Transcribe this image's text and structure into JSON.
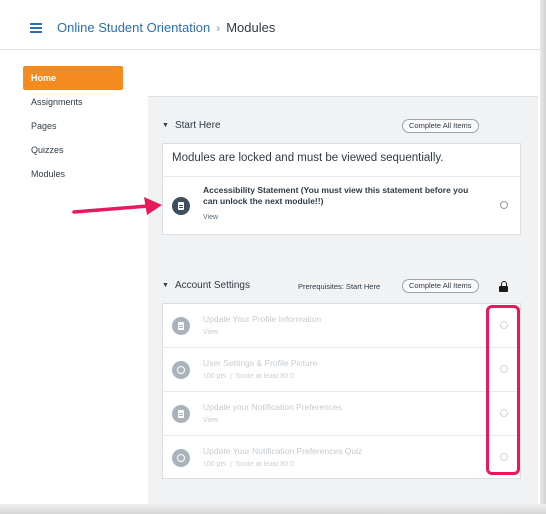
{
  "header": {
    "course": "Online Student Orientation",
    "separator": "›",
    "current": "Modules"
  },
  "sidebar": {
    "items": [
      {
        "label": "Home",
        "active": true
      },
      {
        "label": "Assignments"
      },
      {
        "label": "Pages"
      },
      {
        "label": "Quizzes"
      },
      {
        "label": "Modules"
      }
    ]
  },
  "modules": [
    {
      "title": "Start Here",
      "complete_all": "Complete All Items",
      "lock_message": "Modules are locked and must be viewed sequentially.",
      "items": [
        {
          "icon": "document-icon",
          "title": "Accessibility Statement (You must view this statement before you can unlock the next module!!)",
          "subtitle": "View"
        }
      ]
    },
    {
      "title": "Account Settings",
      "prerequisites": "Prerequisites: Start Here",
      "complete_all": "Complete All Items",
      "locked": true,
      "items": [
        {
          "icon": "document-icon",
          "title": "Update Your Profile Information",
          "subtitle": "View"
        },
        {
          "icon": "quiz-icon",
          "title": "User Settings & Profile Picture",
          "subtitle": "100 pts  |  Score at least 80.0"
        },
        {
          "icon": "document-icon",
          "title": "Update your Notification Preferences",
          "subtitle": "View"
        },
        {
          "icon": "quiz-icon",
          "title": "Update Your Notification Preferences Quiz",
          "subtitle": "100 pts  |  Score at least 80.0"
        }
      ]
    }
  ],
  "colors": {
    "accent": "#f58a1f",
    "link": "#2b6fb5",
    "highlight": "#e8195b"
  }
}
